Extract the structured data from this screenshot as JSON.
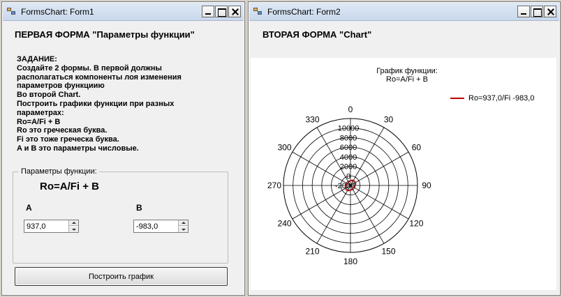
{
  "form1": {
    "title": "FormsChart: Form1",
    "heading": "ПЕРВАЯ ФОРМА \"Параметры функции\"",
    "task_text": "ЗАДАНИЕ:\nСоздайте 2 формы. В первой должны\nрасполагаться компоненты лоя изменения\nпараметров функциию\nВо второй Chart.\nПостроить графики функции при разных\nпараметрах:\nRo=A/Fi + B\nRo это греческая буква.\nFi это тоже греческа буква.\nA и B это параметры числовые.",
    "group_label": "Параметры функции:",
    "formula": "Ro=A/Fi + B",
    "param_a": {
      "label": "A",
      "value": "937,0"
    },
    "param_b": {
      "label": "B",
      "value": "-983,0"
    },
    "build_button": "Построить график"
  },
  "form2": {
    "title": "FormsChart: Form2",
    "heading": "ВТОРАЯ ФОРМА \"Chart\"",
    "chart_title_line1": "График функции:",
    "chart_title_line2": "Ro=A/Fi + B"
  },
  "chart_data": {
    "type": "polar",
    "title": "График функции: Ro=A/Fi + B",
    "angle_ticks": [
      "0",
      "30",
      "60",
      "90",
      "120",
      "150",
      "180",
      "210",
      "240",
      "270",
      "300",
      "330"
    ],
    "radial_ticks": [
      "-2000",
      "0",
      "2000",
      "4000",
      "6000",
      "8000",
      "10000"
    ],
    "radial_range": [
      -2000,
      12000
    ],
    "series": [
      {
        "name": "Ro=937,0/Fi -983,0",
        "color": "#c00000",
        "values_approx": "small loop near centre, |Ro| ≈ 1000"
      }
    ],
    "legend_position": "top-right"
  }
}
